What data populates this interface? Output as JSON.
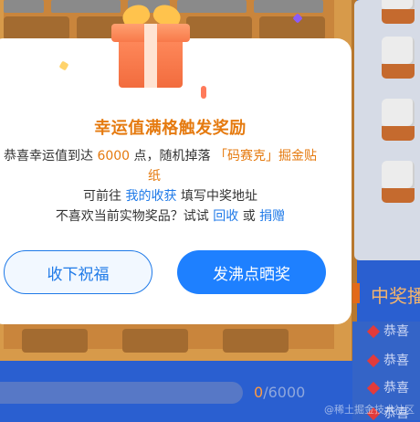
{
  "modal": {
    "title": "幸运值满格触发奖励",
    "line1_prefix": "恭喜幸运值到达 ",
    "line1_points": "6000",
    "line1_mid": " 点，随机掉落 ",
    "line1_prize": "「码赛克」掘金贴",
    "line2_suffix": "纸",
    "line3_prefix": "可前往 ",
    "line3_link": "我的收获",
    "line3_suffix": " 填写中奖地址",
    "line4_prefix": "不喜欢当前实物奖品？试试 ",
    "line4_link_recycle": "回收",
    "line4_or": " 或 ",
    "line4_link_donate": "捐赠",
    "btn_accept": "收下祝福",
    "btn_share": "发沸点晒奖"
  },
  "sidebar": {
    "winner_title": "中奖播",
    "winner_items": [
      "恭喜",
      "恭喜",
      "恭喜",
      "恭喜"
    ]
  },
  "progress": {
    "current": "0",
    "total": "/6000"
  },
  "watermark": "@稀土掘金技术社区",
  "colors": {
    "accent_orange": "#e57a0f",
    "link_blue": "#1f7ae8",
    "primary_button": "#1e80ff",
    "page_background": "#2a5fd0"
  }
}
